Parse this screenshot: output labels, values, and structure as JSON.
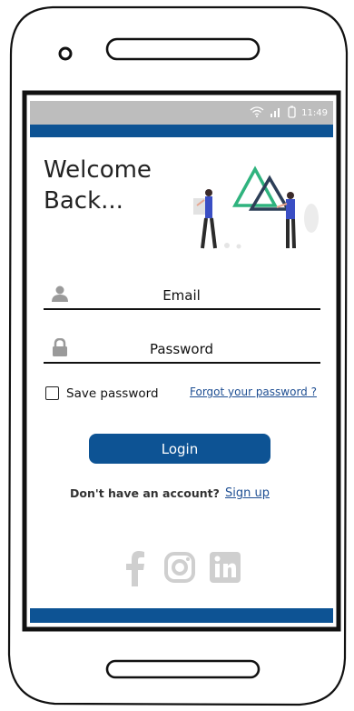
{
  "status_bar": {
    "time": "11:49",
    "icons": [
      "wifi-icon",
      "signal-icon",
      "battery-icon"
    ]
  },
  "header": {
    "title": "Welcome\nBack..."
  },
  "form": {
    "email": {
      "label": "Email",
      "icon": "user-icon"
    },
    "password": {
      "label": "Password",
      "icon": "lock-icon"
    },
    "save_password": {
      "label": "Save password",
      "checked": false
    },
    "forgot_password": "Forgot your password ?",
    "login_button": "Login"
  },
  "signup_prompt": {
    "text": "Don't have an account?",
    "link": "Sign up"
  },
  "social": [
    "facebook-icon",
    "instagram-icon",
    "linkedin-icon"
  ],
  "colors": {
    "primary": "#0d5394",
    "link": "#1f4f93",
    "status_bar": "#bdbdbd",
    "social_icon": "#cfcfcf",
    "illustration_accent": "#2fb37e",
    "illustration_dark": "#2c3e57"
  }
}
